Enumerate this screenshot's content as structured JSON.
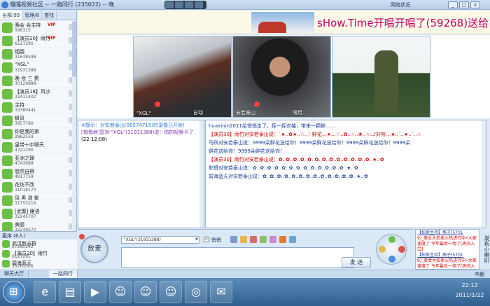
{
  "window": {
    "title": "嘎嘎视频社区 -- 一路同行 (235022) -- 晚",
    "network_label": "网络状况"
  },
  "left_tabs": [
    "全部/99",
    "管理/8",
    "查找"
  ],
  "users": [
    {
      "name": "晚会 会主持",
      "id": "596315",
      "vip": "VIP"
    },
    {
      "name": "【演员20】雨竹",
      "id": "6127295",
      "vip": "VIP"
    },
    {
      "name": "烟霜",
      "id": "31638598",
      "vip": ""
    },
    {
      "name": "\"XGL\"",
      "id": "31931388",
      "vip": ""
    },
    {
      "name": "晚 会 三 费",
      "id": "30129888",
      "vip": ""
    },
    {
      "name": "【演员18】风沙",
      "id": "32411402",
      "vip": ""
    },
    {
      "name": "主持",
      "id": "33380441",
      "vip": ""
    },
    {
      "name": "枫风",
      "id": "3957780",
      "vip": ""
    },
    {
      "name": "你是我的家",
      "id": "2862559",
      "vip": ""
    },
    {
      "name": "皇带十中聊天",
      "id": "4721290",
      "vip": ""
    },
    {
      "name": "亚洲之珊",
      "id": "4743089",
      "vip": ""
    },
    {
      "name": "悠然自得",
      "id": "4917759",
      "vip": ""
    },
    {
      "name": "花炷不改",
      "id": "31018170",
      "vip": ""
    },
    {
      "name": "风 黑 澄 紫",
      "id": "31753216",
      "vip": ""
    },
    {
      "name": "[武警] 雁语",
      "id": "32245707",
      "vip": ""
    },
    {
      "name": "美丽",
      "id": "32249570",
      "vip": ""
    }
  ],
  "mic_queue": {
    "header": "麦序 (6人)",
    "users": [
      {
        "name": "武汉新去群",
        "id": "57280242"
      },
      {
        "name": "【演员20】雨竹",
        "id": "6127295"
      },
      {
        "name": "碧海蓝天",
        "id": "33761306"
      }
    ]
  },
  "banner": {
    "text": "sHow.Time开唱开唱了(59268)送给"
  },
  "videos": [
    {
      "label": "\"XGL\"",
      "extra": "自动"
    },
    {
      "label": "安若泰山",
      "extra": "限用"
    },
    {
      "label": "",
      "extra": ""
    }
  ],
  "chat_left": {
    "system": "※提示：对安若泰山(56574715)的录像已开始!",
    "from": "[悄悄地]您对 \"XGL\"(31931388)说：你的视频卡了",
    "time": "(22:12:08)"
  },
  "chat_right": {
    "lines": [
      {
        "text": "huaxinin2011给悄悄走了，挥一挥衣袖，带来一颗鲜……",
        "cls": "b"
      },
      {
        "text": "【演员30】雨竹对安若泰山说：`★..✿★..☆..♡鲜花…★…☆..✿..☆..❀..☆..♪好听…★..`..★..`..☆",
        "cls": "r"
      },
      {
        "text": "马跃对安若泰山说：9999朵鲜花送给你！9999朵鲜花送给你！9999朵鲜花送给你！9999朵",
        "cls": "b"
      },
      {
        "text": "鲜花送给你！9999朵鲜花送给你！",
        "cls": "b"
      },
      {
        "text": "【演员30】雨竹对安若泰山说：✿..✿..✿..✿..✿..✿..✿..✿..✿..✿..✿..✿..✿..★..✿",
        "cls": "r"
      },
      {
        "text": "影蟒对安若泰山说：✿..✿..✿..✿..✿..✿..✿..✿..✿..✿..✿..✿..✿..★..✿",
        "cls": "b"
      },
      {
        "text": "碧海蓝天对安若泰山说：✿..✿..✿..✿..✿..✿..✿..✿..✿..✿..✿..✿..✿..★..✿",
        "cls": "b"
      }
    ]
  },
  "controls": {
    "mic_label": "放麦",
    "target_user": "\"XGL\"(31931388)",
    "whisper_label": "悄悄",
    "send_label": "发 送"
  },
  "ads": [
    {
      "title": "【拍卖主持】燕子(5701",
      "line": "9)_美女大拍卖火热进行中•大家速度了 今年最后一场了[房间入口]"
    },
    {
      "title": "【拍卖主持】燕子(5701",
      "line": "9)_美女大拍卖火热进行中•大家速度了 今年最后一场了[房间入口]"
    }
  ],
  "vertical_tab": "发布小喇叭",
  "app_tabs": [
    "聊天大厅",
    "一路同行"
  ],
  "pager": "卒翻",
  "taskbar": {
    "time": "22:12",
    "date": "2011/1/22"
  },
  "colors": {
    "accent": "#c0006a",
    "chat_red": "#cc0000",
    "chat_blue": "#1d3f9c"
  }
}
